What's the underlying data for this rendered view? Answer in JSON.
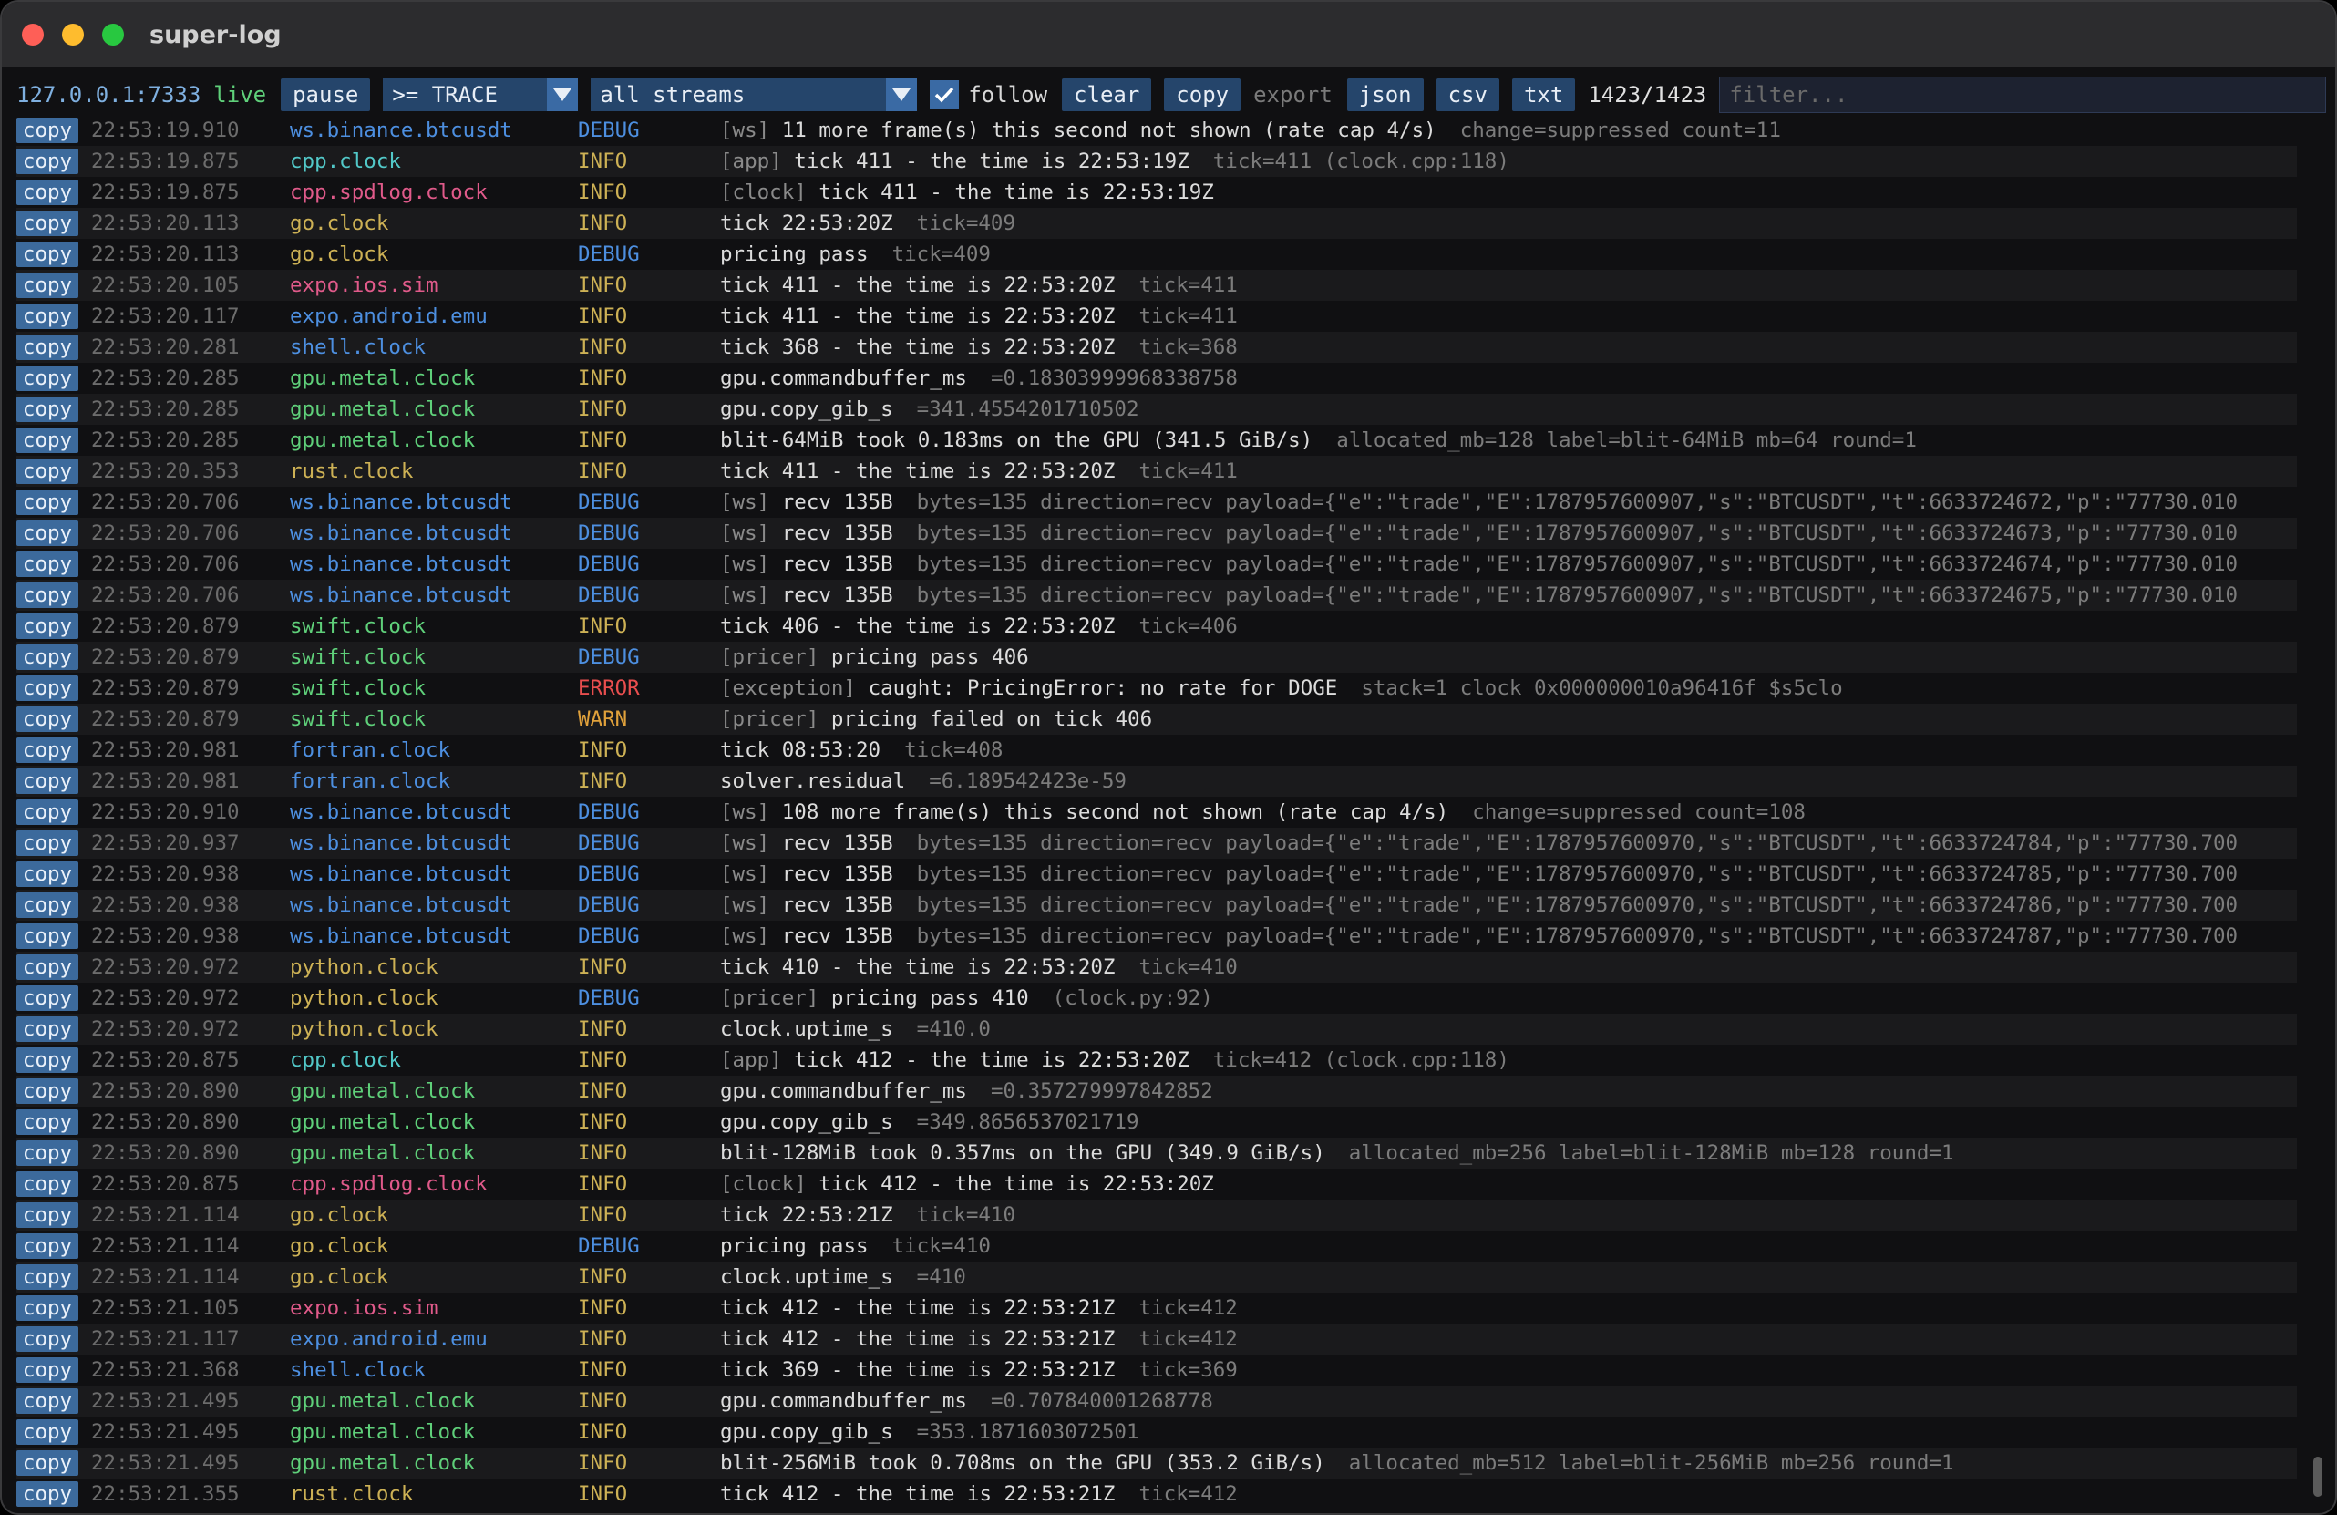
{
  "window": {
    "title": "super-log"
  },
  "toolbar": {
    "address": "127.0.0.1:7333",
    "status": "live",
    "pause_label": "pause",
    "level_value": ">= TRACE",
    "stream_value": "all streams",
    "follow_label": "follow",
    "clear_label": "clear",
    "copy_label": "copy",
    "export_label": "export",
    "json_label": "json",
    "csv_label": "csv",
    "txt_label": "txt",
    "count": "1423/1423",
    "filter_placeholder": "filter..."
  },
  "colors": {
    "blue": "#4d8fe0",
    "teal": "#52c8c8",
    "pink": "#e05a8a",
    "gold": "#cdb155",
    "green": "#5fd07a",
    "info": "#cdb155",
    "debug": "#4d8fe0",
    "error": "#e84e4e",
    "warn": "#e0a13b"
  },
  "rows": [
    {
      "copy": "copy",
      "ts": "22:53:19.910",
      "src": "ws.binance.btcusdt",
      "sc": "blue",
      "lvl": "DEBUG",
      "pre": "[ws]",
      "msg": "11 more frame(s) this second not shown (rate cap 4/s)",
      "kv": "change=suppressed count=11"
    },
    {
      "copy": "copy",
      "ts": "22:53:19.875",
      "src": "cpp.clock",
      "sc": "teal",
      "lvl": "INFO",
      "pre": "[app]",
      "msg": "tick 411 - the time is 22:53:19Z",
      "kv": "tick=411 (clock.cpp:118)"
    },
    {
      "copy": "copy",
      "ts": "22:53:19.875",
      "src": "cpp.spdlog.clock",
      "sc": "pink",
      "lvl": "INFO",
      "pre": "[clock]",
      "msg": "tick 411 - the time is 22:53:19Z",
      "kv": ""
    },
    {
      "copy": "copy",
      "ts": "22:53:20.113",
      "src": "go.clock",
      "sc": "gold",
      "lvl": "INFO",
      "pre": "",
      "msg": "tick 22:53:20Z",
      "kv": "tick=409"
    },
    {
      "copy": "copy",
      "ts": "22:53:20.113",
      "src": "go.clock",
      "sc": "gold",
      "lvl": "DEBUG",
      "pre": "",
      "msg": "pricing pass",
      "kv": "tick=409"
    },
    {
      "copy": "copy",
      "ts": "22:53:20.105",
      "src": "expo.ios.sim",
      "sc": "pink",
      "lvl": "INFO",
      "pre": "",
      "msg": "tick 411 - the time is 22:53:20Z",
      "kv": "tick=411"
    },
    {
      "copy": "copy",
      "ts": "22:53:20.117",
      "src": "expo.android.emu",
      "sc": "blue",
      "lvl": "INFO",
      "pre": "",
      "msg": "tick 411 - the time is 22:53:20Z",
      "kv": "tick=411"
    },
    {
      "copy": "copy",
      "ts": "22:53:20.281",
      "src": "shell.clock",
      "sc": "blue",
      "lvl": "INFO",
      "pre": "",
      "msg": "tick 368 - the time is 22:53:20Z",
      "kv": "tick=368"
    },
    {
      "copy": "copy",
      "ts": "22:53:20.285",
      "src": "gpu.metal.clock",
      "sc": "green",
      "lvl": "INFO",
      "pre": "",
      "msg": "gpu.commandbuffer_ms",
      "kv": "=0.18303999968338758"
    },
    {
      "copy": "copy",
      "ts": "22:53:20.285",
      "src": "gpu.metal.clock",
      "sc": "green",
      "lvl": "INFO",
      "pre": "",
      "msg": "gpu.copy_gib_s",
      "kv": "=341.4554201710502"
    },
    {
      "copy": "copy",
      "ts": "22:53:20.285",
      "src": "gpu.metal.clock",
      "sc": "green",
      "lvl": "INFO",
      "pre": "",
      "msg": "blit-64MiB took 0.183ms on the GPU (341.5 GiB/s)",
      "kv": "allocated_mb=128 label=blit-64MiB mb=64 round=1"
    },
    {
      "copy": "copy",
      "ts": "22:53:20.353",
      "src": "rust.clock",
      "sc": "gold",
      "lvl": "INFO",
      "pre": "",
      "msg": "tick 411 - the time is 22:53:20Z",
      "kv": "tick=411"
    },
    {
      "copy": "copy",
      "ts": "22:53:20.706",
      "src": "ws.binance.btcusdt",
      "sc": "blue",
      "lvl": "DEBUG",
      "pre": "[ws]",
      "msg": "recv 135B",
      "kv": "bytes=135 direction=recv payload={\"e\":\"trade\",\"E\":1787957600907,\"s\":\"BTCUSDT\",\"t\":6633724672,\"p\":\"77730.010"
    },
    {
      "copy": "copy",
      "ts": "22:53:20.706",
      "src": "ws.binance.btcusdt",
      "sc": "blue",
      "lvl": "DEBUG",
      "pre": "[ws]",
      "msg": "recv 135B",
      "kv": "bytes=135 direction=recv payload={\"e\":\"trade\",\"E\":1787957600907,\"s\":\"BTCUSDT\",\"t\":6633724673,\"p\":\"77730.010"
    },
    {
      "copy": "copy",
      "ts": "22:53:20.706",
      "src": "ws.binance.btcusdt",
      "sc": "blue",
      "lvl": "DEBUG",
      "pre": "[ws]",
      "msg": "recv 135B",
      "kv": "bytes=135 direction=recv payload={\"e\":\"trade\",\"E\":1787957600907,\"s\":\"BTCUSDT\",\"t\":6633724674,\"p\":\"77730.010"
    },
    {
      "copy": "copy",
      "ts": "22:53:20.706",
      "src": "ws.binance.btcusdt",
      "sc": "blue",
      "lvl": "DEBUG",
      "pre": "[ws]",
      "msg": "recv 135B",
      "kv": "bytes=135 direction=recv payload={\"e\":\"trade\",\"E\":1787957600907,\"s\":\"BTCUSDT\",\"t\":6633724675,\"p\":\"77730.010"
    },
    {
      "copy": "copy",
      "ts": "22:53:20.879",
      "src": "swift.clock",
      "sc": "green",
      "lvl": "INFO",
      "pre": "",
      "msg": "tick 406 - the time is 22:53:20Z",
      "kv": "tick=406"
    },
    {
      "copy": "copy",
      "ts": "22:53:20.879",
      "src": "swift.clock",
      "sc": "green",
      "lvl": "DEBUG",
      "pre": "[pricer]",
      "msg": "pricing pass 406",
      "kv": ""
    },
    {
      "copy": "copy",
      "ts": "22:53:20.879",
      "src": "swift.clock",
      "sc": "green",
      "lvl": "ERROR",
      "pre": "[exception]",
      "msg": "caught: PricingError: no rate for DOGE",
      "kv": "stack=1   clock                                      0x000000010a96416f $s5clo"
    },
    {
      "copy": "copy",
      "ts": "22:53:20.879",
      "src": "swift.clock",
      "sc": "green",
      "lvl": "WARN",
      "pre": "[pricer]",
      "msg": "pricing failed on tick 406",
      "kv": ""
    },
    {
      "copy": "copy",
      "ts": "22:53:20.981",
      "src": "fortran.clock",
      "sc": "blue",
      "lvl": "INFO",
      "pre": "",
      "msg": "tick 08:53:20",
      "kv": "tick=408"
    },
    {
      "copy": "copy",
      "ts": "22:53:20.981",
      "src": "fortran.clock",
      "sc": "blue",
      "lvl": "INFO",
      "pre": "",
      "msg": "solver.residual",
      "kv": "=6.189542423e-59"
    },
    {
      "copy": "copy",
      "ts": "22:53:20.910",
      "src": "ws.binance.btcusdt",
      "sc": "blue",
      "lvl": "DEBUG",
      "pre": "[ws]",
      "msg": "108 more frame(s) this second not shown (rate cap 4/s)",
      "kv": "change=suppressed count=108"
    },
    {
      "copy": "copy",
      "ts": "22:53:20.937",
      "src": "ws.binance.btcusdt",
      "sc": "blue",
      "lvl": "DEBUG",
      "pre": "[ws]",
      "msg": "recv 135B",
      "kv": "bytes=135 direction=recv payload={\"e\":\"trade\",\"E\":1787957600970,\"s\":\"BTCUSDT\",\"t\":6633724784,\"p\":\"77730.700"
    },
    {
      "copy": "copy",
      "ts": "22:53:20.938",
      "src": "ws.binance.btcusdt",
      "sc": "blue",
      "lvl": "DEBUG",
      "pre": "[ws]",
      "msg": "recv 135B",
      "kv": "bytes=135 direction=recv payload={\"e\":\"trade\",\"E\":1787957600970,\"s\":\"BTCUSDT\",\"t\":6633724785,\"p\":\"77730.700"
    },
    {
      "copy": "copy",
      "ts": "22:53:20.938",
      "src": "ws.binance.btcusdt",
      "sc": "blue",
      "lvl": "DEBUG",
      "pre": "[ws]",
      "msg": "recv 135B",
      "kv": "bytes=135 direction=recv payload={\"e\":\"trade\",\"E\":1787957600970,\"s\":\"BTCUSDT\",\"t\":6633724786,\"p\":\"77730.700"
    },
    {
      "copy": "copy",
      "ts": "22:53:20.938",
      "src": "ws.binance.btcusdt",
      "sc": "blue",
      "lvl": "DEBUG",
      "pre": "[ws]",
      "msg": "recv 135B",
      "kv": "bytes=135 direction=recv payload={\"e\":\"trade\",\"E\":1787957600970,\"s\":\"BTCUSDT\",\"t\":6633724787,\"p\":\"77730.700"
    },
    {
      "copy": "copy",
      "ts": "22:53:20.972",
      "src": "python.clock",
      "sc": "gold",
      "lvl": "INFO",
      "pre": "",
      "msg": "tick 410 - the time is 22:53:20Z",
      "kv": "tick=410"
    },
    {
      "copy": "copy",
      "ts": "22:53:20.972",
      "src": "python.clock",
      "sc": "gold",
      "lvl": "DEBUG",
      "pre": "[pricer]",
      "msg": "pricing pass 410",
      "kv": "(clock.py:92)"
    },
    {
      "copy": "copy",
      "ts": "22:53:20.972",
      "src": "python.clock",
      "sc": "gold",
      "lvl": "INFO",
      "pre": "",
      "msg": "clock.uptime_s",
      "kv": "=410.0"
    },
    {
      "copy": "copy",
      "ts": "22:53:20.875",
      "src": "cpp.clock",
      "sc": "teal",
      "lvl": "INFO",
      "pre": "[app]",
      "msg": "tick 412 - the time is 22:53:20Z",
      "kv": "tick=412 (clock.cpp:118)"
    },
    {
      "copy": "copy",
      "ts": "22:53:20.890",
      "src": "gpu.metal.clock",
      "sc": "green",
      "lvl": "INFO",
      "pre": "",
      "msg": "gpu.commandbuffer_ms",
      "kv": "=0.357279997842852"
    },
    {
      "copy": "copy",
      "ts": "22:53:20.890",
      "src": "gpu.metal.clock",
      "sc": "green",
      "lvl": "INFO",
      "pre": "",
      "msg": "gpu.copy_gib_s",
      "kv": "=349.8656537021719"
    },
    {
      "copy": "copy",
      "ts": "22:53:20.890",
      "src": "gpu.metal.clock",
      "sc": "green",
      "lvl": "INFO",
      "pre": "",
      "msg": "blit-128MiB took 0.357ms on the GPU (349.9 GiB/s)",
      "kv": "allocated_mb=256 label=blit-128MiB mb=128 round=1"
    },
    {
      "copy": "copy",
      "ts": "22:53:20.875",
      "src": "cpp.spdlog.clock",
      "sc": "pink",
      "lvl": "INFO",
      "pre": "[clock]",
      "msg": "tick 412 - the time is 22:53:20Z",
      "kv": ""
    },
    {
      "copy": "copy",
      "ts": "22:53:21.114",
      "src": "go.clock",
      "sc": "gold",
      "lvl": "INFO",
      "pre": "",
      "msg": "tick 22:53:21Z",
      "kv": "tick=410"
    },
    {
      "copy": "copy",
      "ts": "22:53:21.114",
      "src": "go.clock",
      "sc": "gold",
      "lvl": "DEBUG",
      "pre": "",
      "msg": "pricing pass",
      "kv": "tick=410"
    },
    {
      "copy": "copy",
      "ts": "22:53:21.114",
      "src": "go.clock",
      "sc": "gold",
      "lvl": "INFO",
      "pre": "",
      "msg": "clock.uptime_s",
      "kv": "=410"
    },
    {
      "copy": "copy",
      "ts": "22:53:21.105",
      "src": "expo.ios.sim",
      "sc": "pink",
      "lvl": "INFO",
      "pre": "",
      "msg": "tick 412 - the time is 22:53:21Z",
      "kv": "tick=412"
    },
    {
      "copy": "copy",
      "ts": "22:53:21.117",
      "src": "expo.android.emu",
      "sc": "blue",
      "lvl": "INFO",
      "pre": "",
      "msg": "tick 412 - the time is 22:53:21Z",
      "kv": "tick=412"
    },
    {
      "copy": "copy",
      "ts": "22:53:21.368",
      "src": "shell.clock",
      "sc": "blue",
      "lvl": "INFO",
      "pre": "",
      "msg": "tick 369 - the time is 22:53:21Z",
      "kv": "tick=369"
    },
    {
      "copy": "copy",
      "ts": "22:53:21.495",
      "src": "gpu.metal.clock",
      "sc": "green",
      "lvl": "INFO",
      "pre": "",
      "msg": "gpu.commandbuffer_ms",
      "kv": "=0.707840001268778"
    },
    {
      "copy": "copy",
      "ts": "22:53:21.495",
      "src": "gpu.metal.clock",
      "sc": "green",
      "lvl": "INFO",
      "pre": "",
      "msg": "gpu.copy_gib_s",
      "kv": "=353.1871603072501"
    },
    {
      "copy": "copy",
      "ts": "22:53:21.495",
      "src": "gpu.metal.clock",
      "sc": "green",
      "lvl": "INFO",
      "pre": "",
      "msg": "blit-256MiB took 0.708ms on the GPU (353.2 GiB/s)",
      "kv": "allocated_mb=512 label=blit-256MiB mb=256 round=1"
    },
    {
      "copy": "copy",
      "ts": "22:53:21.355",
      "src": "rust.clock",
      "sc": "gold",
      "lvl": "INFO",
      "pre": "",
      "msg": "tick 412 - the time is 22:53:21Z",
      "kv": "tick=412"
    }
  ]
}
